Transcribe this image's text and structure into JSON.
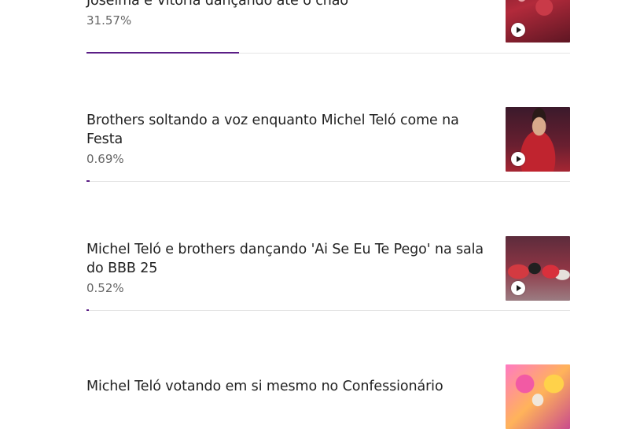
{
  "poll": {
    "options": [
      {
        "title": "Joselma e Vitória dançando até o chão",
        "percent_label": "31.57%",
        "percent": 31.57,
        "thumbnail": "party-dance-red",
        "icon": "play-icon"
      },
      {
        "title": "Brothers soltando a voz enquanto Michel Teló come na Festa",
        "percent_label": "0.69%",
        "percent": 0.69,
        "thumbnail": "singer-with-microphone",
        "icon": "play-icon"
      },
      {
        "title": "Michel Teló e brothers dançando 'Ai Se Eu Te Pego' na sala do BBB 25",
        "percent_label": "0.52%",
        "percent": 0.52,
        "thumbnail": "group-dancing",
        "icon": "play-icon"
      },
      {
        "title": "Michel Teló votando em si mesmo no Confessionário",
        "thumbnail": "confessionario-colorful"
      }
    ]
  },
  "colors": {
    "bar_fill": "#5b1e86",
    "bar_track": "#e4e4e4",
    "title_text": "#222222",
    "percent_text": "#666666"
  }
}
